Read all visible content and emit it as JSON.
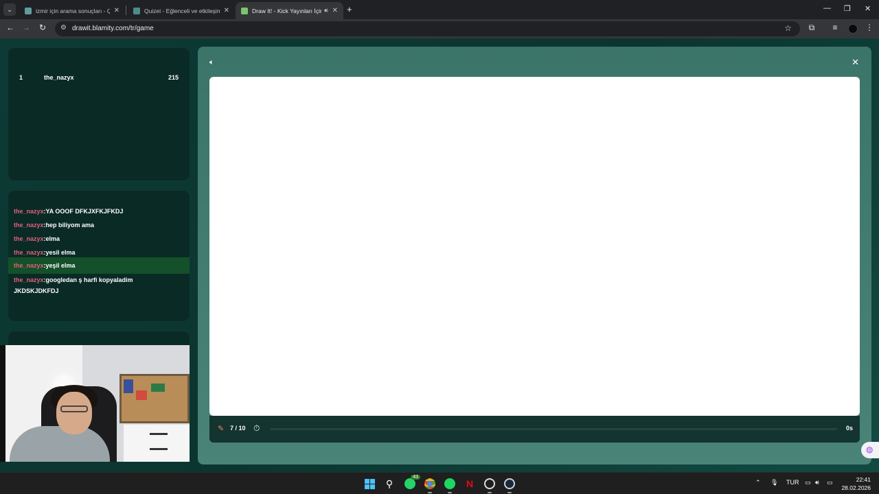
{
  "browser": {
    "tabs": [
      {
        "title": "izmir için arama sonuçları - Qui",
        "favicon_color": "#5f9ea0",
        "active": false
      },
      {
        "title": "Quizei - Eğlenceli ve etkileşimli",
        "favicon_color": "#4f8a8b",
        "active": false
      },
      {
        "title": "Draw It! - Kick Yayınları İçin",
        "favicon_color": "#7cc46c",
        "active": true,
        "audio": true
      }
    ],
    "url": "drawit.blamity.com/tr/game"
  },
  "leaderboard": {
    "rows": [
      {
        "rank": "1",
        "name": "the_nazyx",
        "score": "215"
      }
    ]
  },
  "chat": {
    "messages": [
      {
        "user": "the_nazyx",
        "text": ":YA OOOF DFKJXFKJFKDJ",
        "highlight": false
      },
      {
        "user": "the_nazyx",
        "text": ":hep biliyom ama",
        "highlight": false
      },
      {
        "user": "the_nazyx",
        "text": ":elma",
        "highlight": false
      },
      {
        "user": "the_nazyx",
        "text": ":yesil elma",
        "highlight": false
      },
      {
        "user": "the_nazyx",
        "text": ":yeşil elma",
        "highlight": true
      },
      {
        "user": "the_nazyx",
        "text": ":googledan ş harfi kopyaladim",
        "line2": "JKDSKJDKFDJ",
        "highlight": false
      }
    ]
  },
  "game": {
    "round": "7 / 10",
    "time_left": "0s",
    "progress": 0
  },
  "taskbar": {
    "whatsapp_badge": "43",
    "language": "TUR",
    "time": "22:41",
    "date": "28.02.2026"
  },
  "colors": {
    "accent_user": "#e0607a",
    "highlight_row": "#14502a",
    "page_bg": "#0b3530"
  }
}
